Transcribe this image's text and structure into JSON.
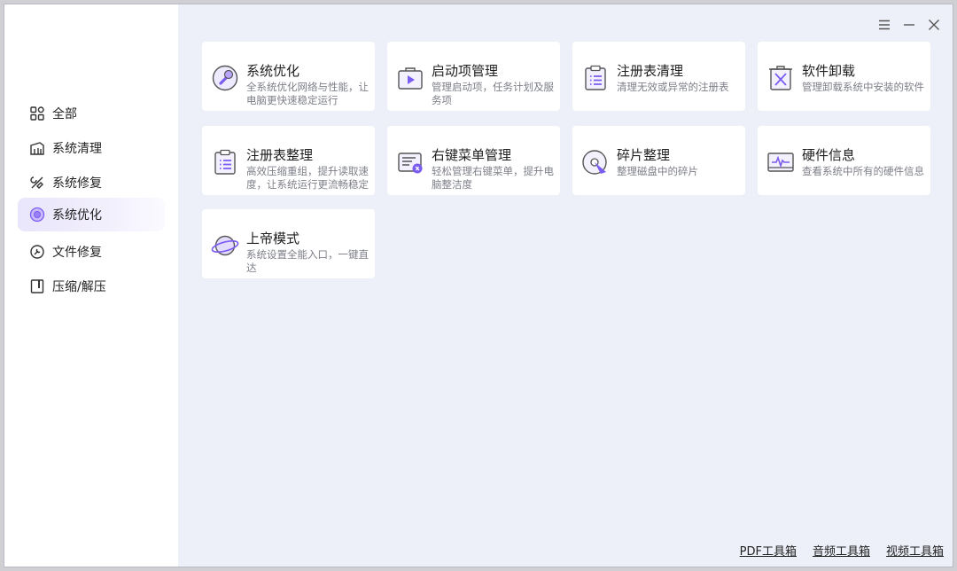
{
  "colors": {
    "accent": "#7b5cf0",
    "accent_light": "#e3dcfd",
    "background": "#eef0f9",
    "card": "#ffffff"
  },
  "window_controls": [
    {
      "icon": "menu-icon"
    },
    {
      "icon": "minimize-icon"
    },
    {
      "icon": "close-icon"
    }
  ],
  "sidebar": {
    "items": [
      {
        "label": "全部",
        "icon": "grid-icon"
      },
      {
        "label": "系统清理",
        "icon": "broom-icon"
      },
      {
        "label": "系统修复",
        "icon": "tools-icon"
      },
      {
        "label": "系统优化",
        "icon": "disc-icon",
        "active": true
      },
      {
        "label": "文件修复",
        "icon": "file-repair-icon"
      },
      {
        "label": "压缩/解压",
        "icon": "archive-icon"
      }
    ]
  },
  "tools": [
    {
      "title": "系统优化",
      "desc": "全系统优化网络与性能，让电脑更快速稳定运行",
      "icon": "wrench-disc-icon"
    },
    {
      "title": "启动项管理",
      "desc": "管理启动项，任务计划及服务项",
      "icon": "startup-icon"
    },
    {
      "title": "注册表清理",
      "desc": "清理无效或异常的注册表",
      "icon": "clipboard-icon"
    },
    {
      "title": "软件卸载",
      "desc": "管理卸载系统中安装的软件",
      "icon": "uninstall-icon"
    },
    {
      "title": "注册表整理",
      "desc": "高效压缩重组，提升读取速度，让系统运行更流畅稳定",
      "icon": "registry-icon"
    },
    {
      "title": "右键菜单管理",
      "desc": "轻松管理右键菜单，提升电脑整洁度",
      "icon": "context-menu-icon"
    },
    {
      "title": "碎片整理",
      "desc": "整理磁盘中的碎片",
      "icon": "defrag-icon"
    },
    {
      "title": "硬件信息",
      "desc": "查看系统中所有的硬件信息",
      "icon": "hardware-icon"
    },
    {
      "title": "上帝模式",
      "desc": "系统设置全能入口，一键直达",
      "icon": "planet-icon"
    }
  ],
  "footer": {
    "links": [
      "PDF工具箱",
      "音频工具箱",
      "视频工具箱"
    ]
  }
}
